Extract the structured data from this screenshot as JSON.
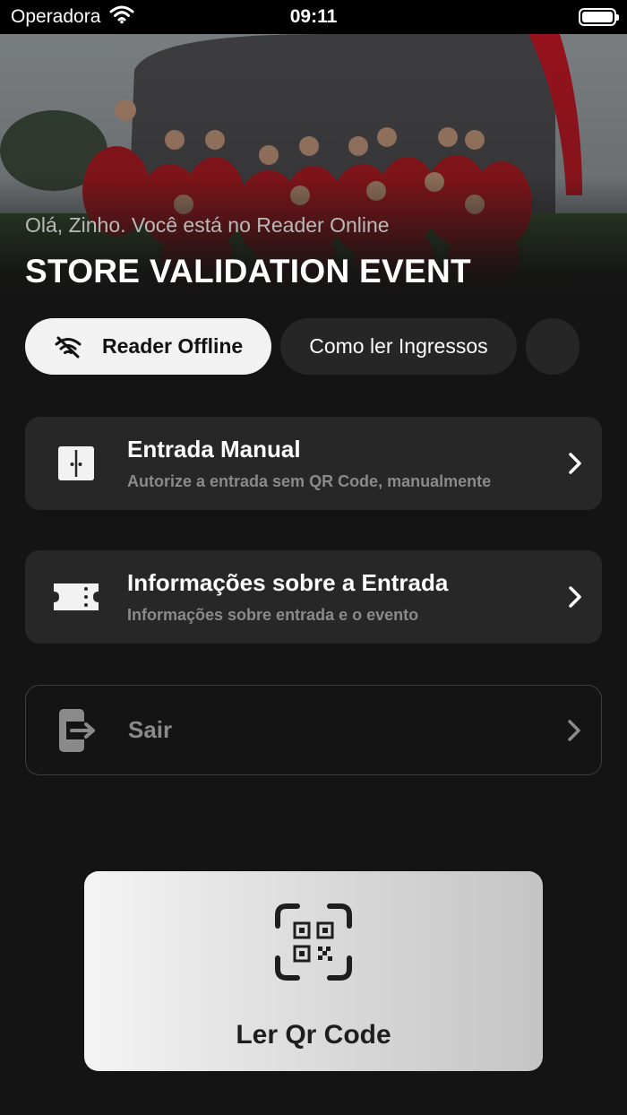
{
  "status_bar": {
    "carrier": "Operadora",
    "time": "09:11"
  },
  "hero": {
    "greeting": "Olá, Zinho. Você está no Reader Online",
    "title": "STORE VALIDATION EVENT"
  },
  "chips": [
    {
      "label": "Reader Offline",
      "icon": "wifi-off-icon"
    },
    {
      "label": "Como ler Ingressos"
    }
  ],
  "menu": [
    {
      "title": "Entrada Manual",
      "subtitle": "Autorize a entrada sem QR Code, manualmente",
      "icon": "door-icon"
    },
    {
      "title": "Informações sobre a Entrada",
      "subtitle": "Informações sobre entrada e o evento",
      "icon": "ticket-icon"
    },
    {
      "title": "Sair",
      "icon": "logout-icon"
    }
  ],
  "qr_button": {
    "label": "Ler Qr Code",
    "icon": "qr-code-scan-icon"
  },
  "colors": {
    "background": "#141414",
    "card": "#272727",
    "chip_active": "#f2f2f2"
  }
}
